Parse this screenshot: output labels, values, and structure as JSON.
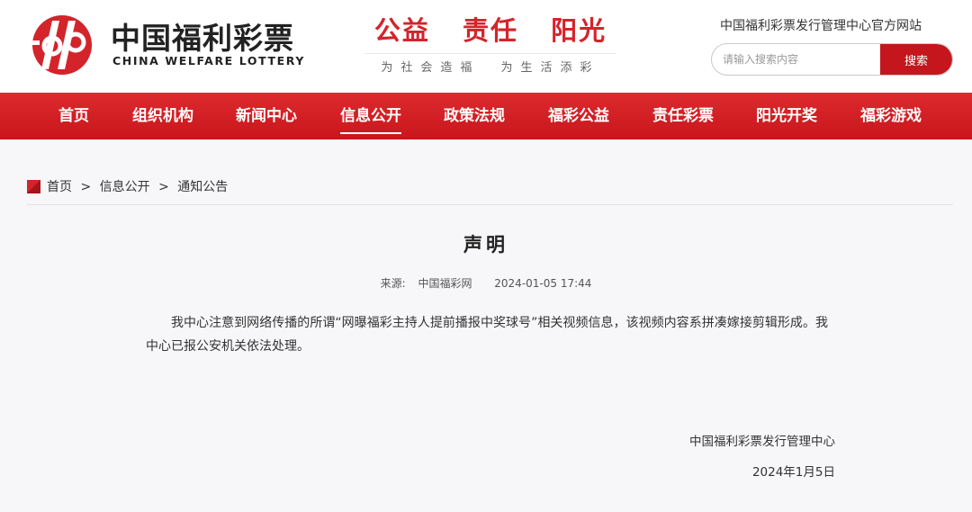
{
  "brand": {
    "name_cn": "中国福利彩票",
    "name_en": "CHINA WELFARE LOTTERY",
    "logo_icon": "welfare-lottery-logo",
    "color_primary": "#d4242b"
  },
  "slogan": {
    "main": "公益 责任 阳光",
    "sub": "为社会造福 为生活添彩"
  },
  "site_title": "中国福利彩票发行管理中心官方网站",
  "search": {
    "placeholder": "请输入搜索内容",
    "button_label": "搜索"
  },
  "nav": {
    "items": [
      {
        "label": "首页"
      },
      {
        "label": "组织机构"
      },
      {
        "label": "新闻中心"
      },
      {
        "label": "信息公开",
        "active": true
      },
      {
        "label": "政策法规"
      },
      {
        "label": "福彩公益"
      },
      {
        "label": "责任彩票"
      },
      {
        "label": "阳光开奖"
      },
      {
        "label": "福彩游戏"
      }
    ]
  },
  "breadcrumb": {
    "items": [
      "首页",
      "信息公开",
      "通知公告"
    ],
    "separator": ">"
  },
  "article": {
    "title": "声明",
    "source_label": "来源:",
    "source": "中国福彩网",
    "datetime": "2024-01-05 17:44",
    "body": "我中心注意到网络传播的所谓“网曝福彩主持人提前播报中奖球号”相关视频信息，该视频内容系拼凑嫁接剪辑形成。我中心已报公安机关依法处理。",
    "signature_org": "中国福利彩票发行管理中心",
    "signature_date": "2024年1月5日"
  }
}
